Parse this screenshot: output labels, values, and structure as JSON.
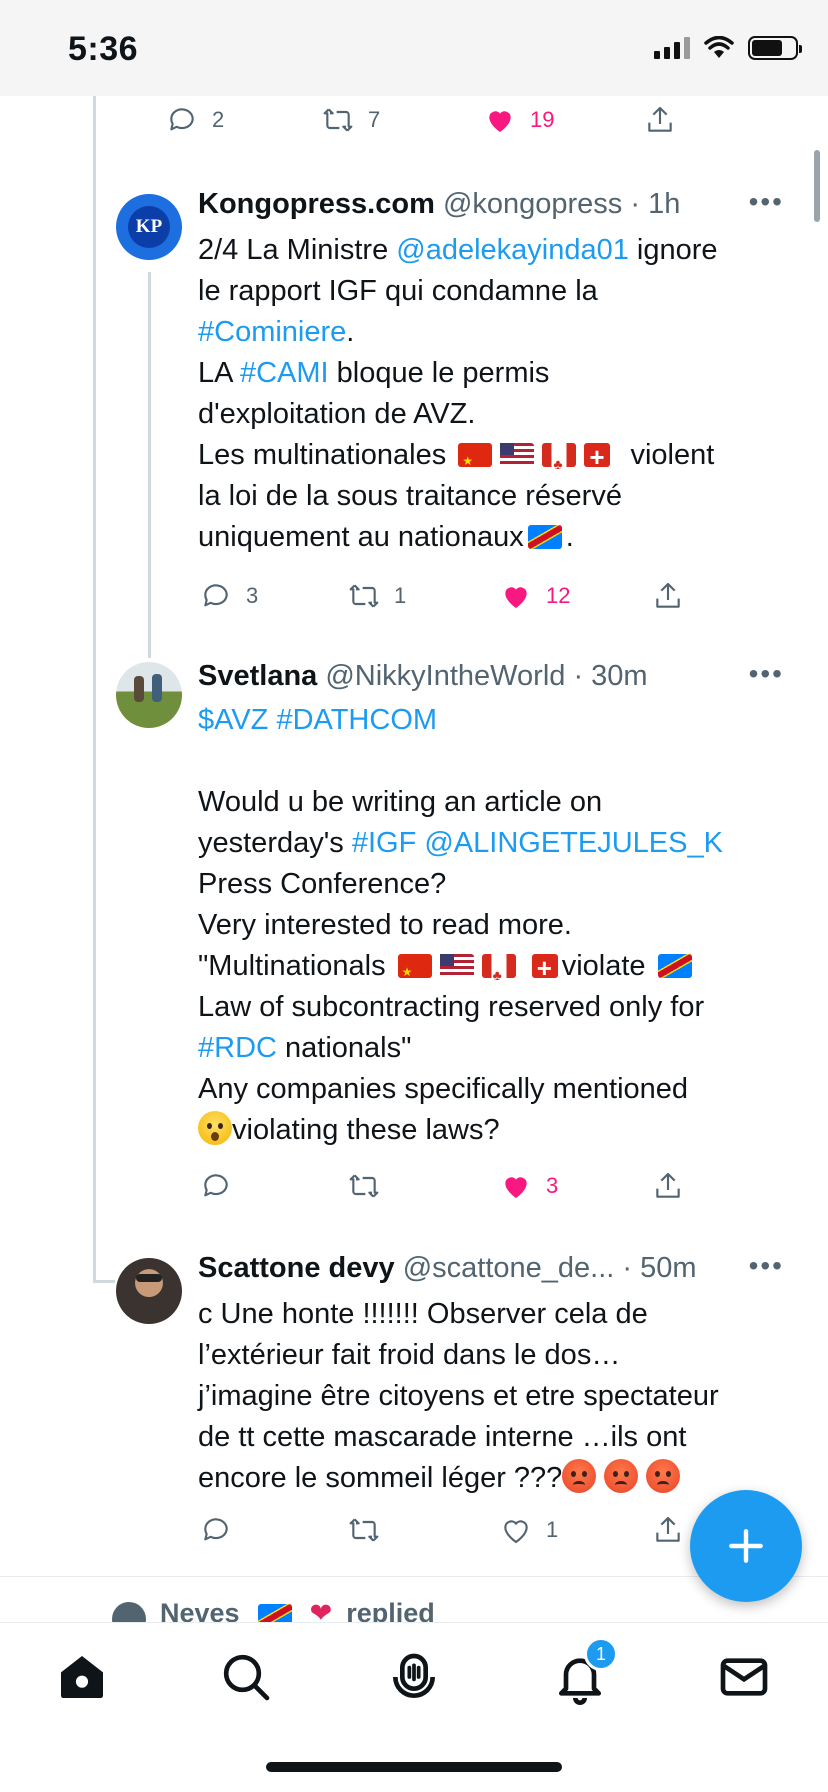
{
  "status_bar": {
    "time": "5:36"
  },
  "top_actions": {
    "reply_count": "2",
    "retweet_count": "7",
    "like_count": "19"
  },
  "tweets": [
    {
      "avatar_text": "KP",
      "name": "Kongopress.com",
      "handle": "@kongopress",
      "time": "· 1h",
      "lines": [
        [
          "2/4 La Ministre ",
          "@adelekayinda01",
          " ignore"
        ],
        [
          "le rapport IGF qui condamne la"
        ],
        [
          "#Cominiere",
          "."
        ],
        [
          "LA ",
          "#CAMI",
          " bloque le permis"
        ],
        [
          "d'exploitation de AVZ."
        ],
        [
          "Les multinationales",
          "violent"
        ],
        [
          "la loi de la sous traitance réservé"
        ],
        [
          "uniquement au nationaux",
          "."
        ]
      ],
      "reply_count": "3",
      "retweet_count": "1",
      "like_count": "12"
    },
    {
      "name": "Svetlana",
      "handle": "@NikkyIntheWorld",
      "time": "· 30m",
      "lines": [
        [
          "$AVZ",
          "#DATHCOM"
        ],
        [
          "Would u be writing an article on"
        ],
        [
          "yesterday's ",
          "#IGF",
          "@ALINGETEJULES_K"
        ],
        [
          "Press Conference?"
        ],
        [
          "Very interested to read more."
        ],
        [
          "\"Multinationals",
          "violate"
        ],
        [
          "Law of subcontracting reserved only for"
        ],
        [
          "#RDC",
          " nationals\""
        ],
        [
          "Any companies specifically mentioned"
        ],
        [
          "violating these laws?"
        ]
      ],
      "like_count": "3"
    },
    {
      "name": "Scattone devy",
      "handle": "@scattone_de...",
      "time": "· 50m",
      "lines": [
        [
          "c Une honte !!!!!!! Observer cela de"
        ],
        [
          "l’extérieur fait froid dans le dos…"
        ],
        [
          "j’imagine être citoyens et etre spectateur"
        ],
        [
          "de tt cette mascarade interne …ils ont"
        ],
        [
          "encore le sommeil léger ???"
        ]
      ],
      "like_count": "1"
    }
  ],
  "more_label": "•••",
  "reply_peek": {
    "name": "Neves",
    "suffix": "replied"
  },
  "tabbar": {
    "notifications_badge": "1"
  },
  "colors": {
    "accent": "#1d9bf0",
    "like": "#f91880",
    "muted": "#536471"
  }
}
